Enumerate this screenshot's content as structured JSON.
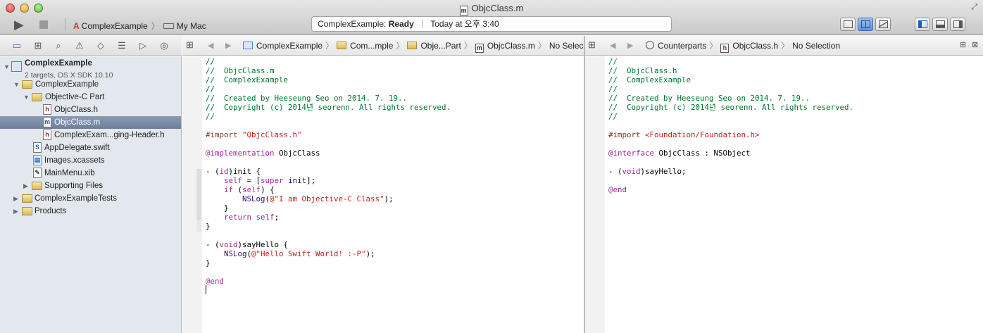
{
  "window": {
    "title": "ObjcClass.m",
    "title_file_icon": "m"
  },
  "toolbar": {
    "run_icon": "▶",
    "scheme": {
      "project": "ComplexExample",
      "destination": "My Mac"
    },
    "activity": {
      "project": "ComplexExample:",
      "status": "Ready",
      "time": "Today at 오후 3:40"
    },
    "editor_modes": [
      "standard-editor-icon",
      "assistant-editor-icon",
      "version-editor-icon"
    ],
    "view_toggles": [
      "navigator-toggle-icon",
      "debug-area-toggle-icon",
      "utilities-toggle-icon"
    ]
  },
  "navigator": {
    "tabs": [
      "project-navigator-icon",
      "symbol-navigator-icon",
      "find-navigator-icon",
      "issue-navigator-icon",
      "test-navigator-icon",
      "debug-navigator-icon",
      "breakpoint-navigator-icon",
      "log-navigator-icon"
    ],
    "project": {
      "name": "ComplexExample",
      "subtitle": "2 targets, OS X SDK 10.10"
    },
    "items": [
      {
        "label": "ComplexExample",
        "kind": "folder"
      },
      {
        "label": "Objective-C Part",
        "kind": "folder"
      },
      {
        "label": "ObjcClass.h",
        "kind": "file",
        "glyph": "h"
      },
      {
        "label": "ObjcClass.m",
        "kind": "file",
        "glyph": "m",
        "selected": true
      },
      {
        "label": "ComplexExam...ging-Header.h",
        "kind": "file",
        "glyph": "h"
      },
      {
        "label": "AppDelegate.swift",
        "kind": "file",
        "glyph": "S"
      },
      {
        "label": "Images.xcassets",
        "kind": "file",
        "glyph": "▤"
      },
      {
        "label": "MainMenu.xib",
        "kind": "file",
        "glyph": "✎"
      },
      {
        "label": "Supporting Files",
        "kind": "folder"
      },
      {
        "label": "ComplexExampleTests",
        "kind": "folder"
      },
      {
        "label": "Products",
        "kind": "folder"
      }
    ]
  },
  "left_editor": {
    "jump_bar": {
      "crumbs": [
        "ComplexExample",
        "Com...mple",
        "Obje...Part",
        "ObjcClass.m",
        "No Selection"
      ]
    },
    "code": [
      {
        "t": "c",
        "v": "//"
      },
      {
        "t": "c",
        "v": "//  ObjcClass.m"
      },
      {
        "t": "c",
        "v": "//  ComplexExample"
      },
      {
        "t": "c",
        "v": "//"
      },
      {
        "t": "c",
        "v": "//  Created by Heeseung Seo on 2014. 7. 19.."
      },
      {
        "t": "c",
        "v": "//  Copyright (c) 2014년 seorenn. All rights reserved."
      },
      {
        "t": "c",
        "v": "//"
      },
      {
        "t": "blank",
        "v": ""
      },
      {
        "t": "import",
        "kw": "#import",
        "v": "\"ObjcClass.h\""
      },
      {
        "t": "blank",
        "v": ""
      },
      {
        "t": "impl",
        "kw": "@implementation",
        "v": " ObjcClass"
      },
      {
        "t": "blank",
        "v": ""
      },
      {
        "t": "method",
        "a": "- (",
        "kw": "id",
        "b": ")init {"
      },
      {
        "t": "selfsuper",
        "a": "    ",
        "kw1": "self",
        "b": " = [",
        "kw2": "super",
        "c": " init",
        "d": "];"
      },
      {
        "t": "ifself",
        "a": "    ",
        "kw1": "if",
        "b": " (",
        "kw2": "self",
        "c": ") {"
      },
      {
        "t": "nslog",
        "a": "        ",
        "fn": "NSLog",
        "b": "(",
        "str": "@\"I am Objective-C Class\"",
        "c": ");"
      },
      {
        "t": "plain",
        "v": "    }"
      },
      {
        "t": "ret",
        "a": "    ",
        "kw1": "return",
        "b": " ",
        "kw2": "self",
        "c": ";"
      },
      {
        "t": "plain",
        "v": "}"
      },
      {
        "t": "blank",
        "v": ""
      },
      {
        "t": "method",
        "a": "- (",
        "kw": "void",
        "b": ")sayHello {"
      },
      {
        "t": "nslog",
        "a": "    ",
        "fn": "NSLog",
        "b": "(",
        "str": "@\"Hello Swift World! :-P\"",
        "c": ");"
      },
      {
        "t": "plain",
        "v": "}"
      },
      {
        "t": "blank",
        "v": ""
      },
      {
        "t": "end",
        "kw": "@end",
        "v": ""
      }
    ]
  },
  "right_editor": {
    "jump_bar": {
      "crumbs": [
        "Counterparts",
        "ObjcClass.h",
        "No Selection"
      ]
    },
    "code": [
      {
        "t": "c",
        "v": "//"
      },
      {
        "t": "c",
        "v": "//  ObjcClass.h"
      },
      {
        "t": "c",
        "v": "//  ComplexExample"
      },
      {
        "t": "c",
        "v": "//"
      },
      {
        "t": "c",
        "v": "//  Created by Heeseung Seo on 2014. 7. 19.."
      },
      {
        "t": "c",
        "v": "//  Copyright (c) 2014년 seorenn. All rights reserved."
      },
      {
        "t": "c",
        "v": "//"
      },
      {
        "t": "blank",
        "v": ""
      },
      {
        "t": "import",
        "kw": "#import",
        "v": "<Foundation/Foundation.h>"
      },
      {
        "t": "blank",
        "v": ""
      },
      {
        "t": "impl",
        "kw": "@interface",
        "v": " ObjcClass : NSObject"
      },
      {
        "t": "blank",
        "v": ""
      },
      {
        "t": "method",
        "a": "- (",
        "kw": "void",
        "b": ")sayHello;"
      },
      {
        "t": "blank",
        "v": ""
      },
      {
        "t": "end",
        "kw": "@end",
        "v": ""
      }
    ]
  },
  "colors": {
    "comment": "#00742d",
    "keyword": "#a02b93",
    "string": "#c41a16",
    "selection": "#7a8ca6"
  }
}
